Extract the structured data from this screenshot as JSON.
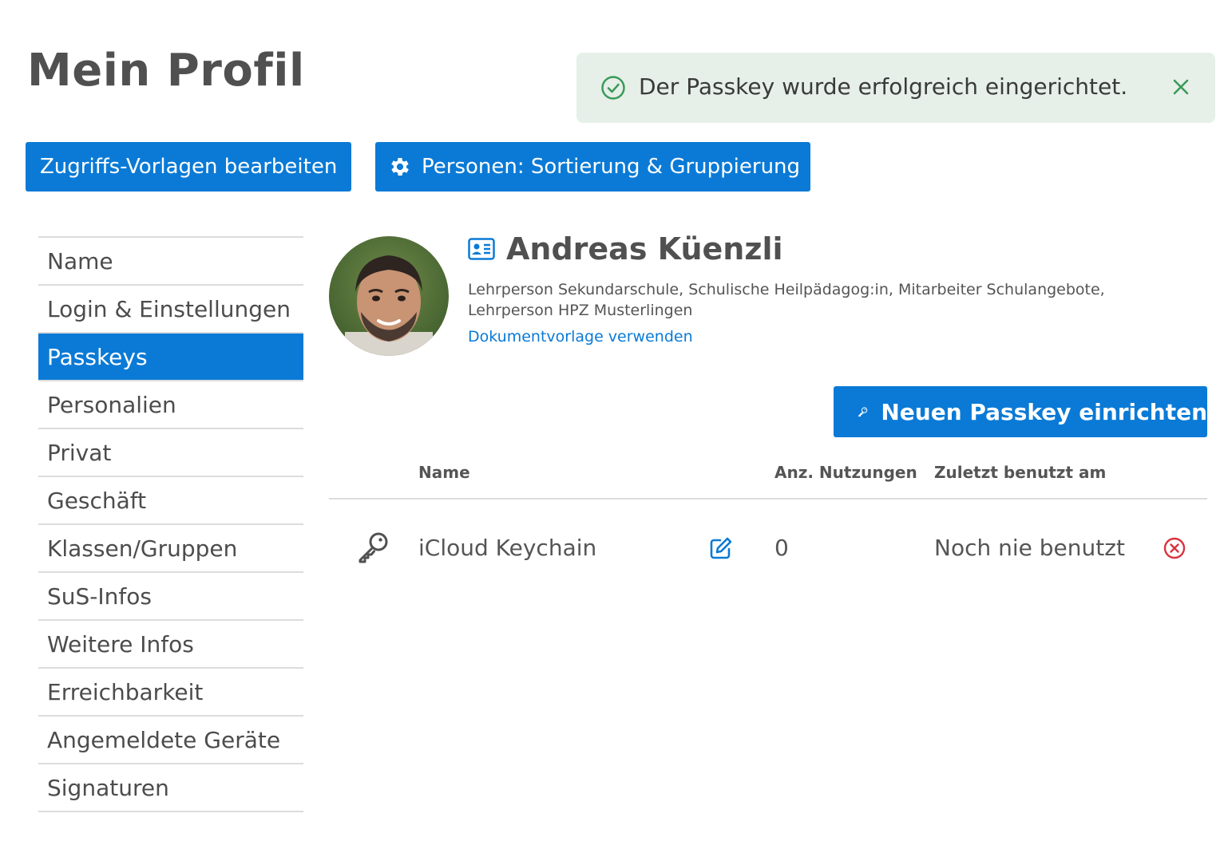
{
  "header": {
    "title": "Mein Profil"
  },
  "alert": {
    "message": "Der Passkey wurde erfolgreich eingerichtet.",
    "icon": "check-circle-icon",
    "close_icon": "close-icon"
  },
  "toolbar": {
    "templates_label": "Zugriffs-Vorlagen bearbeiten",
    "sorting_label": "Personen: Sortierung & Gruppierung"
  },
  "sidebar": {
    "items": [
      {
        "label": "Name"
      },
      {
        "label": "Login & Einstellungen"
      },
      {
        "label": "Passkeys"
      },
      {
        "label": "Personalien"
      },
      {
        "label": "Privat"
      },
      {
        "label": "Geschäft"
      },
      {
        "label": "Klassen/Gruppen"
      },
      {
        "label": "SuS-Infos"
      },
      {
        "label": "Weitere Infos"
      },
      {
        "label": "Erreichbarkeit"
      },
      {
        "label": "Angemeldete Geräte"
      },
      {
        "label": "Signaturen"
      }
    ],
    "active_index": 2
  },
  "profile": {
    "name": "Andreas Küenzli",
    "roles": "Lehrperson Sekundarschule, Schulische Heilpädagog:in, Mitarbeiter Schulangebote, Lehrperson HPZ Musterlingen",
    "doc_link": "Dokumentvorlage verwenden"
  },
  "passkeys": {
    "new_button": "Neuen Passkey einrichten",
    "columns": {
      "name": "Name",
      "uses": "Anz. Nutzungen",
      "last_used": "Zuletzt benutzt am"
    },
    "rows": [
      {
        "name": "iCloud Keychain",
        "uses": "0",
        "last_used": "Noch nie benutzt"
      }
    ]
  },
  "colors": {
    "primary": "#0a7ad6",
    "success": "#3a9a5a",
    "alert_bg": "#e6efe8",
    "danger": "#d9343f"
  }
}
